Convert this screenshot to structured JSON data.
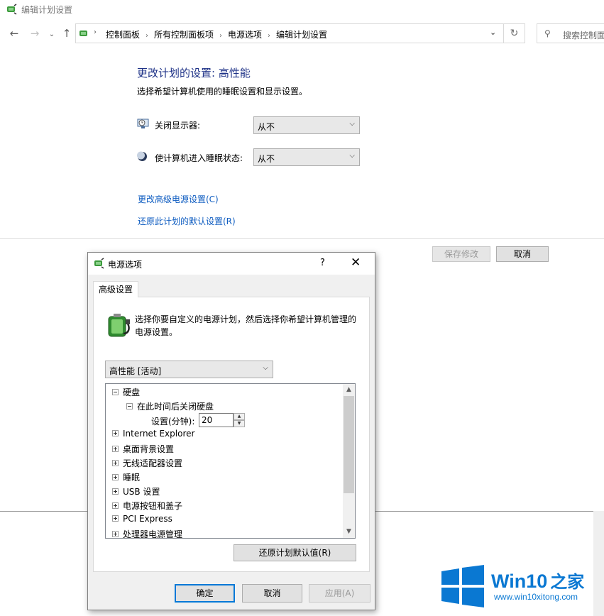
{
  "window": {
    "title": "编辑计划设置",
    "breadcrumbs": [
      "控制面板",
      "所有控制面板项",
      "电源选项",
      "编辑计划设置"
    ],
    "search_placeholder": "搜索控制面"
  },
  "main": {
    "heading": "更改计划的设置: 高性能",
    "subtitle": "选择希望计算机使用的睡眠设置和显示设置。",
    "display_label": "关闭显示器:",
    "display_value": "从不",
    "sleep_label": "使计算机进入睡眠状态:",
    "sleep_value": "从不",
    "link_advanced": "更改高级电源设置(C)",
    "link_restore": "还原此计划的默认设置(R)",
    "save_button": "保存修改",
    "cancel_button": "取消"
  },
  "dialog": {
    "title": "电源选项",
    "help": "?",
    "close": "✕",
    "tab": "高级设置",
    "description": "选择你要自定义的电源计划，然后选择你希望计算机管理的电源设置。",
    "plan_value": "高性能 [活动]",
    "tree": {
      "hard_disk": "硬盘",
      "turn_off_disk": "在此时间后关闭硬盘",
      "setting_label": "设置(分钟):",
      "setting_value": "20",
      "items": [
        "Internet Explorer",
        "桌面背景设置",
        "无线适配器设置",
        "睡眠",
        "USB 设置",
        "电源按钮和盖子",
        "PCI Express",
        "处理器电源管理"
      ]
    },
    "restore_button": "还原计划默认值(R)",
    "ok_button": "确定",
    "cancel_button": "取消",
    "apply_button": "应用(A)"
  },
  "watermark": {
    "brand": "Win10",
    "brand_suffix": "之家",
    "url": "www.win10xitong.com"
  },
  "colors": {
    "heading": "#1e3287",
    "link": "#0f5dc1",
    "logo_blue": "#0a78d2"
  }
}
